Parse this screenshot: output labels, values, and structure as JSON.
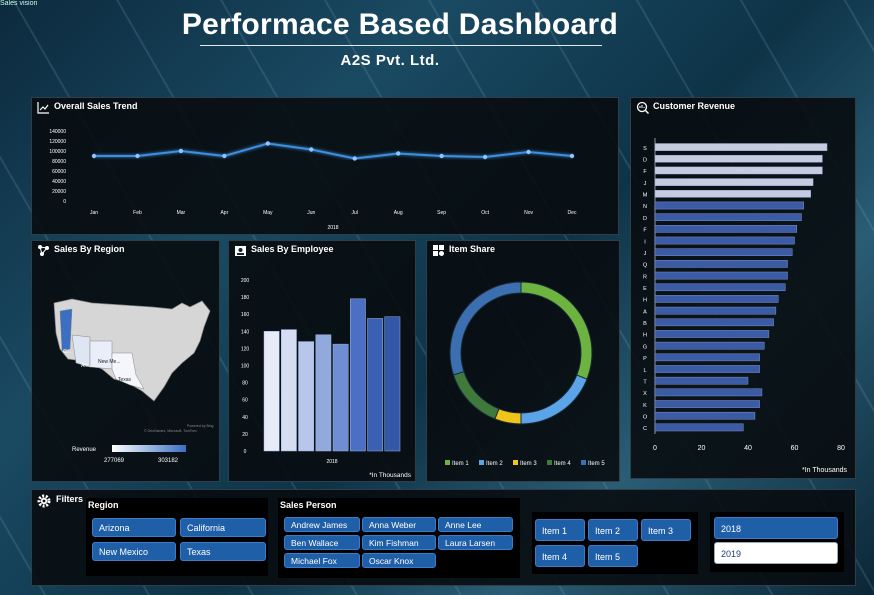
{
  "window_label": "Sales vision",
  "header": {
    "title": "Performace Based Dashboard",
    "subtitle": "A2S  Pvt. Ltd."
  },
  "colors": {
    "accent": "#1f5fa8",
    "line": "#3e8fe0",
    "panel": "#080c10"
  },
  "trend": {
    "title": "Overall Sales Trend",
    "year": "2018",
    "chart_data": {
      "type": "line",
      "categories": [
        "Jan",
        "Feb",
        "Mar",
        "Apr",
        "May",
        "Jun",
        "Jul",
        "Aug",
        "Sep",
        "Oct",
        "Nov",
        "Dec"
      ],
      "values": [
        90000,
        90000,
        100000,
        90000,
        115000,
        103000,
        85000,
        95000,
        90000,
        88000,
        98000,
        90000
      ],
      "yticks": [
        "140000",
        "120000",
        "100000",
        "80000",
        "60000",
        "40000",
        "20000",
        "0"
      ],
      "ylim": [
        0,
        140000
      ],
      "xlabel": "2018"
    }
  },
  "region": {
    "title": "Sales By Region",
    "labels": [
      "Ari...",
      "New Me...",
      "Texas"
    ],
    "watermark_lines": [
      "Powered by Bing",
      "© GeoNames, Microsoft, TomTom"
    ],
    "legend": {
      "title": "Revenue",
      "min": "277069",
      "max": "303182"
    }
  },
  "employee": {
    "title": "Sales By Employee",
    "note": "*In Thousands",
    "chart_data": {
      "type": "bar",
      "values": [
        140,
        142,
        128,
        136,
        125,
        178,
        155,
        157
      ],
      "xlabel": "2018",
      "yticks": [
        "200",
        "180",
        "160",
        "140",
        "120",
        "100",
        "80",
        "60",
        "40",
        "20",
        "0"
      ],
      "ylim": [
        0,
        200
      ]
    }
  },
  "itemshare": {
    "title": "Item Share",
    "chart_data": {
      "type": "pie",
      "labels": [
        "Item 1",
        "Item 2",
        "Item 3",
        "Item 4",
        "Item 5"
      ],
      "values": [
        31,
        19,
        6,
        14,
        30
      ],
      "colors": [
        "#6db33f",
        "#5ba4e8",
        "#f0c419",
        "#3f7a3a",
        "#3c6fb0"
      ]
    }
  },
  "customer": {
    "title": "Customer Revenue",
    "note": "*In Thousands",
    "chart_data": {
      "type": "bar",
      "categories": [
        "S",
        "D",
        "F",
        "J",
        "M",
        "N",
        "D",
        "F",
        "I",
        "J",
        "Q",
        "R",
        "E",
        "H",
        "A",
        "B",
        "H",
        "G",
        "P",
        "L",
        "T",
        "X",
        "K",
        "O",
        "C"
      ],
      "values": [
        74,
        72,
        72,
        68,
        67,
        64,
        63,
        61,
        60,
        59,
        57,
        57,
        56,
        53,
        52,
        51,
        49,
        47,
        45,
        45,
        40,
        46,
        45,
        43,
        38
      ],
      "xticks": [
        "0",
        "20",
        "40",
        "60",
        "80"
      ],
      "xlim": [
        0,
        80
      ]
    }
  },
  "filters": {
    "title": "Filters",
    "region_label": "Region",
    "regions": [
      "Arizona",
      "California",
      "New Mexico",
      "Texas"
    ],
    "person_label": "Sales Person",
    "persons": [
      "Andrew James",
      "Anna Weber",
      "Anne Lee",
      "Ben Wallace",
      "Kim Fishman",
      "Laura Larsen",
      "Michael Fox",
      "Oscar Knox"
    ],
    "items": [
      "Item 1",
      "Item 2",
      "Item 3",
      "Item 4",
      "Item 5"
    ],
    "years": [
      "2018",
      "2019"
    ],
    "selected_year": "2019"
  }
}
